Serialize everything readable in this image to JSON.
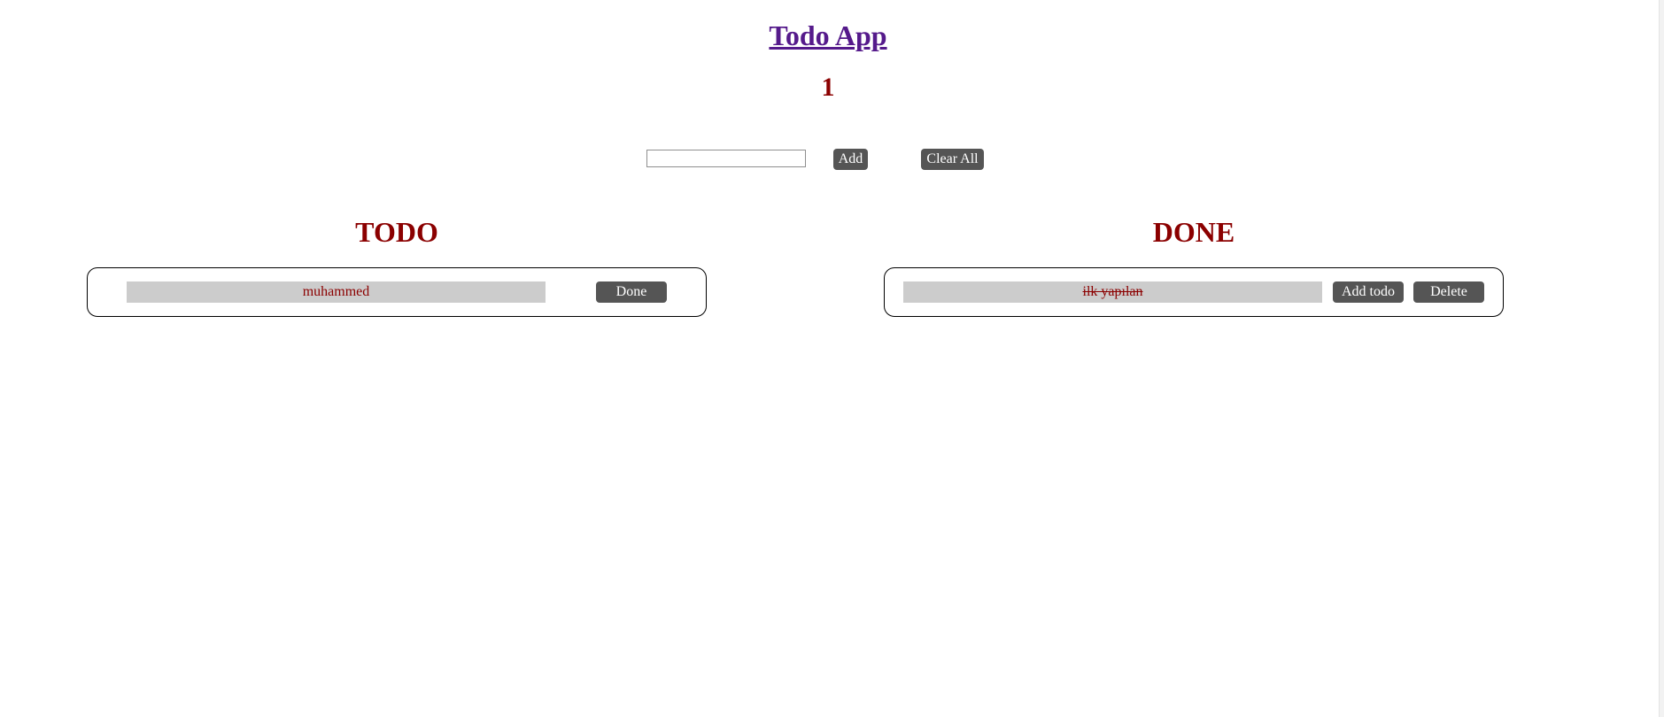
{
  "header": {
    "title": "Todo App",
    "count": "1"
  },
  "form": {
    "input_value": "",
    "add_label": "Add",
    "clear_label": "Clear All"
  },
  "todo": {
    "heading": "TODO",
    "items": [
      {
        "text": "muhammed",
        "done_label": "Done"
      }
    ]
  },
  "done": {
    "heading": "DONE",
    "items": [
      {
        "text": "ilk yapılan",
        "add_todo_label": "Add todo",
        "delete_label": "Delete"
      }
    ]
  },
  "colors": {
    "title_link": "#551a8b",
    "accent_red": "#8b0000",
    "button_bg": "#555555",
    "item_bg": "#cccccc"
  }
}
